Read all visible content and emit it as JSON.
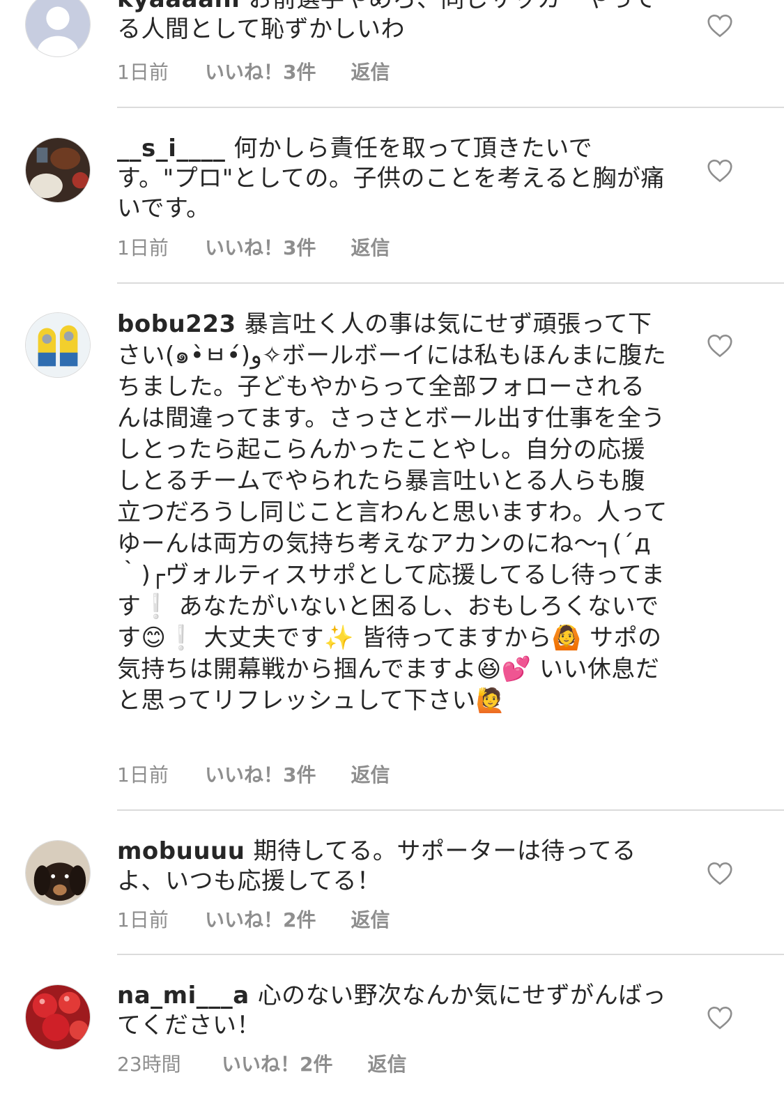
{
  "comments": [
    {
      "username": "kyaaaani",
      "text": "お前選手やめろ、同じサッカーやってる人間として恥ずかしいわ",
      "time": "1日前",
      "likes": "いいね！3件",
      "reply": "返信",
      "avatar_icon": "default-profile-icon"
    },
    {
      "username": "__s_i____",
      "text": "何かしら責任を取って頂きたいです。\"プロ\"としての。子供のことを考えると胸が痛いです。",
      "time": "1日前",
      "likes": "いいね！3件",
      "reply": "返信",
      "avatar_icon": "food-photo-avatar"
    },
    {
      "username": "bobu223",
      "text": "暴言吐く人の事は気にせず頑張って下さい(๑•̀ㅂ•́)و✧ボールボーイには私もほんまに腹たちました。子どもやからって全部フォローされるんは間違ってます。さっさとボール出す仕事を全うしとったら起こらんかったことやし。自分の応援しとるチームでやられたら暴言吐いとる人らも腹立つだろうし同じこと言わんと思いますわ。人ってゆーんは両方の気持ち考えなアカンのにね〜┐(´д｀)┌ヴォルティスサポとして応援してるし待ってます❕ あなたがいないと困るし、おもしろくないです😊❕ 大丈夫です✨ 皆待ってますから🙆 サポの気持ちは開幕戦から掴んでますよ😆💕 いい休息だと思ってリフレッシュして下さい🙋",
      "time": "1日前",
      "likes": "いいね！3件",
      "reply": "返信",
      "avatar_icon": "minion-photo-avatar"
    },
    {
      "username": "mobuuuu",
      "text": "期待してる。サポーターは待ってるよ、いつも応援してる！",
      "time": "1日前",
      "likes": "いいね！2件",
      "reply": "返信",
      "avatar_icon": "dog-photo-avatar"
    },
    {
      "username": "na_mi___a",
      "text": "心のない野次なんか気にせずがんばってください！",
      "time": "23時間",
      "likes": "いいね！2件",
      "reply": "返信",
      "avatar_icon": "tomato-photo-avatar"
    }
  ],
  "colors": {
    "text": "#262626",
    "meta": "#8e8e8e",
    "divider": "#dbdbdb",
    "heart_outline": "#8e8e8e"
  },
  "icons": {
    "like": "heart-outline-icon"
  }
}
